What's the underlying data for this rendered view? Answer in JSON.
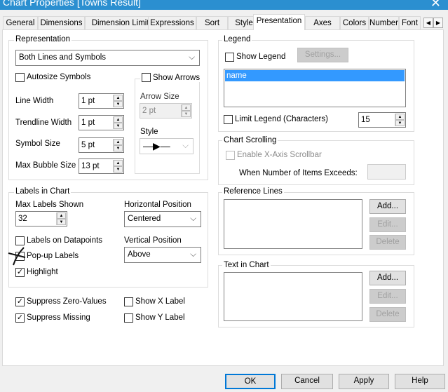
{
  "window": {
    "title": "Chart Properties [Towns Result]"
  },
  "tabs": [
    "General",
    "Dimensions",
    "Dimension Limits",
    "Expressions",
    "Sort",
    "Style",
    "Presentation",
    "Axes",
    "Colors",
    "Number",
    "Font"
  ],
  "representation": {
    "label": "Representation",
    "value": "Both Lines and Symbols",
    "autosize": "Autosize Symbols",
    "line_width_label": "Line Width",
    "line_width": "1 pt",
    "trendline_width_label": "Trendline Width",
    "trendline_width": "1 pt",
    "symbol_size_label": "Symbol Size",
    "symbol_size": "5 pt",
    "max_bubble_label": "Max Bubble Size",
    "max_bubble": "13 pt",
    "show_arrows": "Show Arrows",
    "arrow_size_label": "Arrow Size",
    "arrow_size": "2 pt",
    "style_label": "Style"
  },
  "labels": {
    "label": "Labels in Chart",
    "max_shown_label": "Max Labels Shown",
    "max_shown": "32",
    "hpos_label": "Horizontal Position",
    "hpos": "Centered",
    "on_datapoints": "Labels on Datapoints",
    "vpos_label": "Vertical Position",
    "vpos": "Above",
    "popup": "Pop-up Labels",
    "highlight": "Highlight"
  },
  "suppress": {
    "zero": "Suppress Zero-Values",
    "missing": "Suppress Missing",
    "show_x": "Show X Label",
    "show_y": "Show Y Label"
  },
  "legend": {
    "label": "Legend",
    "show": "Show Legend",
    "settings": "Settings...",
    "items": [
      "name"
    ],
    "limit": "Limit Legend (Characters)",
    "limit_value": "15"
  },
  "scrolling": {
    "label": "Chart Scrolling",
    "enable": "Enable X-Axis Scrollbar",
    "exceeds": "When Number of Items Exceeds:"
  },
  "reference_lines": {
    "label": "Reference Lines",
    "add": "Add...",
    "edit": "Edit...",
    "delete": "Delete"
  },
  "text_in_chart": {
    "label": "Text in Chart",
    "add": "Add...",
    "edit": "Edit...",
    "delete": "Delete"
  },
  "footer": {
    "ok": "OK",
    "cancel": "Cancel",
    "apply": "Apply",
    "help": "Help"
  },
  "colors": {
    "titlebar": "#2b8fd0",
    "selection": "#3399ff",
    "ok_border": "#0078d7"
  }
}
